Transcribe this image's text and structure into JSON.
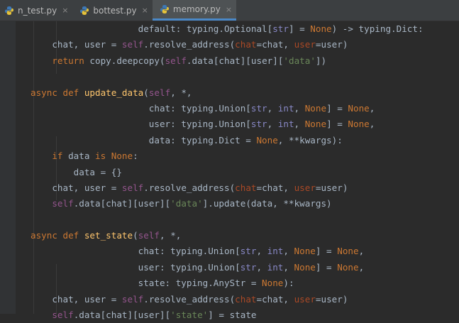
{
  "tabs": [
    {
      "label": "n_test.py",
      "close": "×",
      "active": false
    },
    {
      "label": "bottest.py",
      "close": "×",
      "active": false
    },
    {
      "label": "memory.py",
      "close": "×",
      "active": true
    }
  ],
  "code": {
    "l1": {
      "a": "                    default: typing.Optional[",
      "b": "str",
      "c": "] = ",
      "d": "None",
      "e": ") -> typing.Dict:"
    },
    "l2": {
      "a": "    chat, user = ",
      "b": "self",
      "c": ".resolve_address(",
      "d": "chat",
      "e": "=chat, ",
      "f": "user",
      "g": "=user)"
    },
    "l3": {
      "a": "    ",
      "b": "return",
      "c": " copy.deepcopy(",
      "d": "self",
      "e": ".data[chat][user][",
      "f": "'data'",
      "g": "])"
    },
    "l4": "",
    "l5": {
      "a": "async def",
      "b": " ",
      "c": "update_data",
      "d": "(",
      "e": "self",
      "f": ", *,"
    },
    "l6": {
      "a": "                      chat: typing.Union[",
      "b": "str",
      "c": ", ",
      "d": "int",
      "e": ", ",
      "f": "None",
      "g": "] = ",
      "h": "None",
      "i": ","
    },
    "l7": {
      "a": "                      user: typing.Union[",
      "b": "str",
      "c": ", ",
      "d": "int",
      "e": ", ",
      "f": "None",
      "g": "] = ",
      "h": "None",
      "i": ","
    },
    "l8": {
      "a": "                      data: typing.Dict = ",
      "b": "None",
      "c": ", **kwargs):"
    },
    "l9": {
      "a": "    ",
      "b": "if",
      "c": " data ",
      "d": "is None",
      "e": ":"
    },
    "l10": "        data = {}",
    "l11": {
      "a": "    chat, user = ",
      "b": "self",
      "c": ".resolve_address(",
      "d": "chat",
      "e": "=chat, ",
      "f": "user",
      "g": "=user)"
    },
    "l12": {
      "a": "    ",
      "b": "self",
      "c": ".data[chat][user][",
      "d": "'data'",
      "e": "].update(data, **kwargs)"
    },
    "l13": "",
    "l14": {
      "a": "async def",
      "b": " ",
      "c": "set_state",
      "d": "(",
      "e": "self",
      "f": ", *,"
    },
    "l15": {
      "a": "                    chat: typing.Union[",
      "b": "str",
      "c": ", ",
      "d": "int",
      "e": ", ",
      "f": "None",
      "g": "] = ",
      "h": "None",
      "i": ","
    },
    "l16": {
      "a": "                    user: typing.Union[",
      "b": "str",
      "c": ", ",
      "d": "int",
      "e": ", ",
      "f": "None",
      "g": "] = ",
      "h": "None",
      "i": ","
    },
    "l17": {
      "a": "                    state: typing.AnyStr = ",
      "b": "None",
      "c": "):"
    },
    "l18": {
      "a": "    chat, user = ",
      "b": "self",
      "c": ".resolve_address(",
      "d": "chat",
      "e": "=chat, ",
      "f": "user",
      "g": "=user)"
    },
    "l19": {
      "a": "    ",
      "b": "self",
      "c": ".data[chat][user][",
      "d": "'state'",
      "e": "] = state"
    }
  }
}
